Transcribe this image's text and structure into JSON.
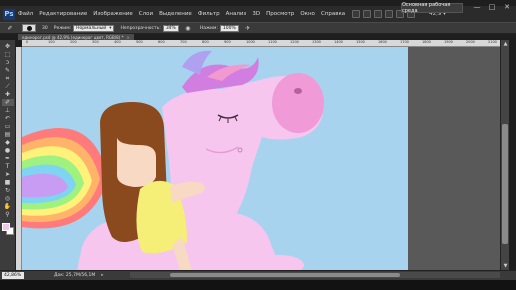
{
  "app": {
    "logo": "Ps"
  },
  "menu": {
    "items": [
      "Файл",
      "Редактирование",
      "Изображение",
      "Слои",
      "Выделение",
      "Фильтр",
      "Анализ",
      "3D",
      "Просмотр",
      "Окно",
      "Справка"
    ],
    "icons": [
      "bridge-icon",
      "minibridge-icon",
      "grid-icon",
      "zoom-level-icon",
      "hand-icon",
      "rotate-view-icon"
    ],
    "zoom_readout": "42,9",
    "zoom_arrow": "▾",
    "workspace_label": "Основная рабочая среда",
    "window_controls": [
      "—",
      "□",
      "✕"
    ]
  },
  "options": {
    "brush_size": "30",
    "mode_label": "Режим:",
    "mode_value": "Нормальный",
    "opacity_label": "Непрозрачность:",
    "opacity_value": "34%",
    "flow_label": "Нажим:",
    "flow_value": "100%"
  },
  "document": {
    "tab_title": "единорог.psd @ 42,9% (единорог цвет, RGB/8) *",
    "close_glyph": "×"
  },
  "ruler": {
    "top_numbers": [
      "0",
      "100",
      "200",
      "300",
      "400",
      "500",
      "600",
      "700",
      "800",
      "900",
      "1000",
      "1100",
      "1200",
      "1300",
      "1400",
      "1500",
      "1600",
      "1700",
      "1800",
      "1900",
      "2000",
      "2100"
    ]
  },
  "tools": [
    {
      "name": "move-tool-icon",
      "glyph": "✥"
    },
    {
      "name": "marquee-tool-icon",
      "glyph": "⬚"
    },
    {
      "name": "lasso-tool-icon",
      "glyph": "ↄ"
    },
    {
      "name": "quick-select-tool-icon",
      "glyph": "✎"
    },
    {
      "name": "crop-tool-icon",
      "glyph": "⌗"
    },
    {
      "name": "eyedropper-tool-icon",
      "glyph": "⟋"
    },
    {
      "name": "healing-tool-icon",
      "glyph": "✚"
    },
    {
      "name": "brush-tool-icon",
      "glyph": "✐"
    },
    {
      "name": "clone-stamp-tool-icon",
      "glyph": "⊥"
    },
    {
      "name": "history-brush-tool-icon",
      "glyph": "↶"
    },
    {
      "name": "eraser-tool-icon",
      "glyph": "▭"
    },
    {
      "name": "gradient-tool-icon",
      "glyph": "▤"
    },
    {
      "name": "blur-tool-icon",
      "glyph": "◆"
    },
    {
      "name": "dodge-tool-icon",
      "glyph": "●"
    },
    {
      "name": "pen-tool-icon",
      "glyph": "✒"
    },
    {
      "name": "type-tool-icon",
      "glyph": "T"
    },
    {
      "name": "path-select-tool-icon",
      "glyph": "➤"
    },
    {
      "name": "shape-tool-icon",
      "glyph": "■"
    },
    {
      "name": "3d-rotate-tool-icon",
      "glyph": "↻"
    },
    {
      "name": "3d-camera-tool-icon",
      "glyph": "◎"
    },
    {
      "name": "hand-tool-icon",
      "glyph": "✋"
    },
    {
      "name": "zoom-tool-icon",
      "glyph": "⚲"
    }
  ],
  "active_tool": "brush-tool-icon",
  "colors": {
    "foreground": "#f2c6ea",
    "background": "#ffffff",
    "canvas_bg": "#a7d3ef",
    "unicorn": "#f6c6ee",
    "unicorn_shadow": "#ecb2e2",
    "snout": "#f09ad7",
    "hair": "#8b4a1d",
    "skin": "#f7d9c4",
    "dress": "#f6ef77"
  },
  "status": {
    "zoom": "42,86%",
    "doc_info": "Док: 25,7M/56,1M",
    "arrow": "▸"
  }
}
